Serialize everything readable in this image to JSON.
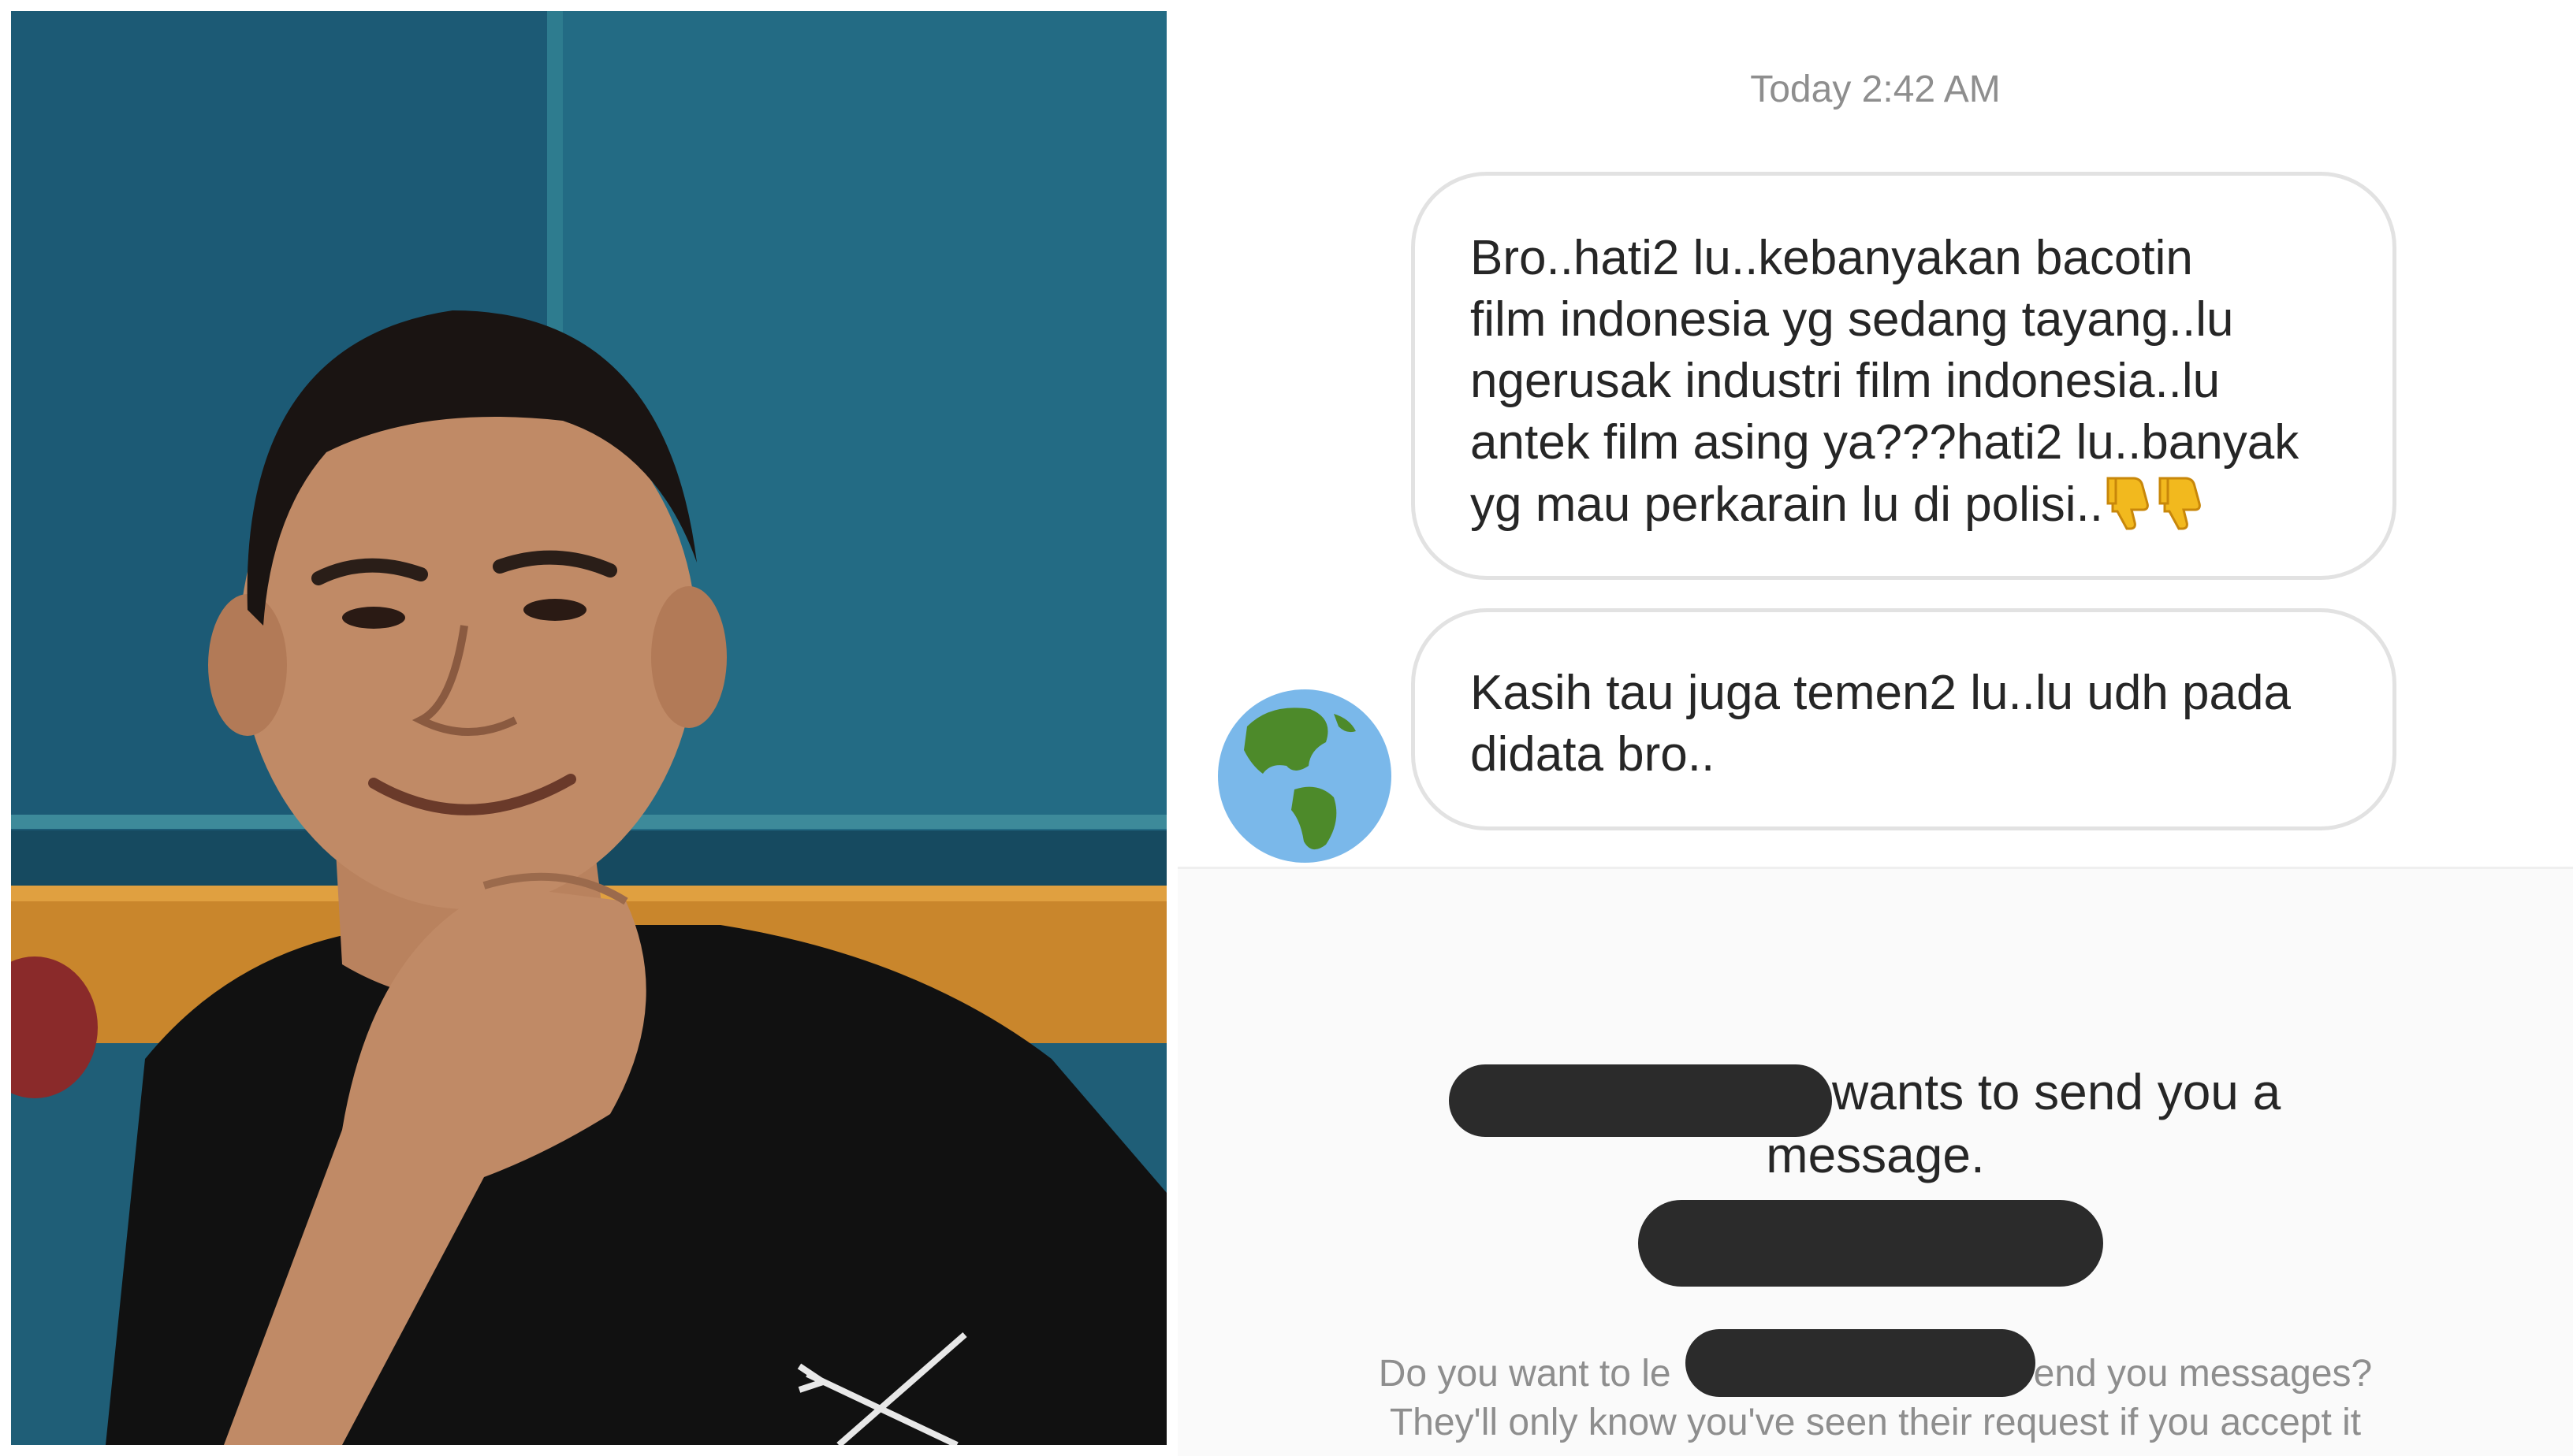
{
  "photo": {
    "description_icon": "man-portrait-photo"
  },
  "chat": {
    "timestamp": "Today 2:42 AM",
    "messages": [
      {
        "text": "Bro..hati2 lu..kebanyakan bacotin\nfilm indonesia yg sedang tayang..lu\nngerusak industri film indonesia..lu\nantek film asing ya???hati2 lu..banyak\nyg mau perkarain lu di polisi..",
        "emoji": [
          "thumbs-down-icon",
          "thumbs-down-icon"
        ]
      },
      {
        "text": "Kasih tau juga temen2 lu..lu udh pada\ndidata bro.."
      }
    ],
    "avatar_icon": "globe-americas-icon",
    "request": {
      "line1": "wants to send you a",
      "line2": "message.",
      "question_part1": "Do you want to le",
      "question_part2": "end you messages?",
      "note": "They'll only know you've seen their request if you accept it"
    }
  },
  "colors": {
    "bubble_border": "#e2e2e2",
    "text_primary": "#262626",
    "text_secondary": "#8e8e8e",
    "redaction": "#2b2b2b"
  }
}
